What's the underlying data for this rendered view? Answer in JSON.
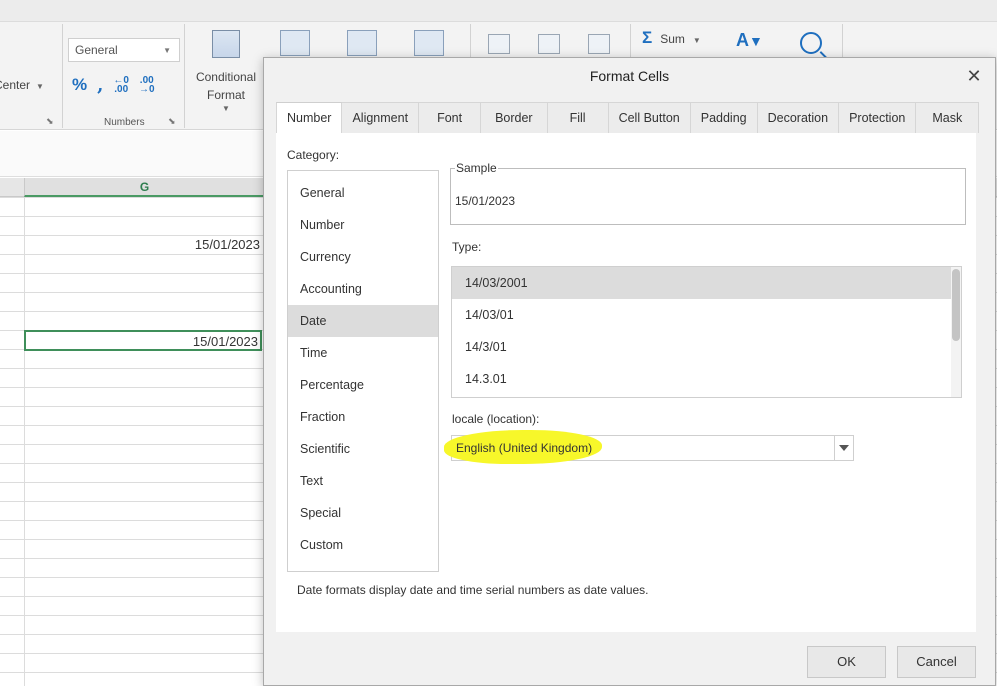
{
  "ribbon": {
    "center_label": "Center",
    "number_format_value": "General",
    "numbers_group_label": "Numbers",
    "conditional_format_label_1": "Conditional",
    "conditional_format_label_2": "Format",
    "sum_label": "Sum"
  },
  "sheet": {
    "column_header": "G",
    "cells": [
      "15/01/2023",
      "15/01/2023"
    ]
  },
  "dialog": {
    "title": "Format Cells",
    "close_symbol": "✕",
    "tabs": [
      {
        "label": "Number"
      },
      {
        "label": "Alignment"
      },
      {
        "label": "Font"
      },
      {
        "label": "Border"
      },
      {
        "label": "Fill"
      },
      {
        "label": "Cell Button"
      },
      {
        "label": "Padding"
      },
      {
        "label": "Decoration"
      },
      {
        "label": "Protection"
      },
      {
        "label": "Mask"
      }
    ],
    "active_tab": "Number",
    "category_label": "Category:",
    "categories": [
      {
        "label": "General"
      },
      {
        "label": "Number"
      },
      {
        "label": "Currency"
      },
      {
        "label": "Accounting"
      },
      {
        "label": "Date"
      },
      {
        "label": "Time"
      },
      {
        "label": "Percentage"
      },
      {
        "label": "Fraction"
      },
      {
        "label": "Scientific"
      },
      {
        "label": "Text"
      },
      {
        "label": "Special"
      },
      {
        "label": "Custom"
      }
    ],
    "selected_category": "Date",
    "sample_label": "Sample",
    "sample_value": "15/01/2023",
    "type_label": "Type:",
    "types": [
      {
        "label": "14/03/2001"
      },
      {
        "label": "14/03/01"
      },
      {
        "label": "14/3/01"
      },
      {
        "label": "14.3.01"
      }
    ],
    "selected_type": "14/03/2001",
    "locale_label": "locale (location):",
    "locale_value": "English (United Kingdom)",
    "description": "Date formats display date and time serial numbers as date values.",
    "ok_label": "OK",
    "cancel_label": "Cancel"
  },
  "colors": {
    "highlight": "#f7f72a",
    "accent_blue": "#1f6fbf",
    "cell_border_green": "#3f8f5a"
  }
}
